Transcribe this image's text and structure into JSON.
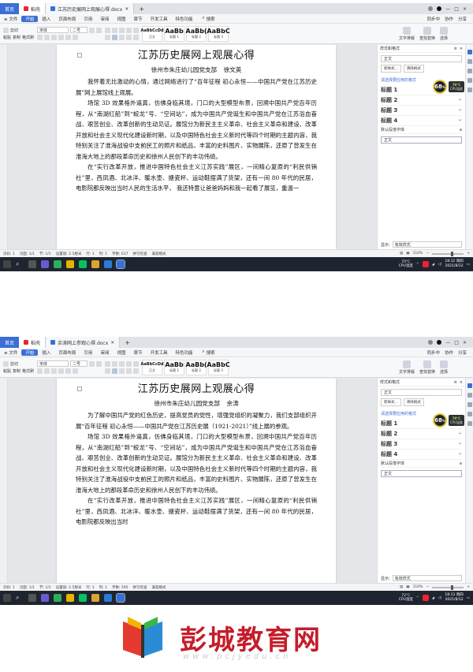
{
  "screenshots": [
    {
      "tabs": {
        "home": "首页",
        "t2": "稻壳",
        "doc": "江苏历史展网上观展心得.docx"
      },
      "menu": {
        "file": "文件",
        "items": [
          "开始",
          "插入",
          "页面布局",
          "引用",
          "审阅",
          "视图",
          "章节",
          "开发工具",
          "特色功能"
        ],
        "search": "搜索",
        "sync": "同步中",
        "collab": "协作",
        "share": "分享"
      },
      "ribbon": {
        "paste": "粘贴",
        "cut": "剪切",
        "copy": "复制",
        "format_painter": "格式刷",
        "font": "宋体",
        "size": "二号",
        "styles": [
          {
            "preview": "AaBbCcDd",
            "name": "正文"
          },
          {
            "preview": "AaBb",
            "name": "标题 1"
          },
          {
            "preview": "AaBb(",
            "name": "标题 2"
          },
          {
            "preview": "AaBbC",
            "name": "标题 3"
          }
        ],
        "text_tools": "文字排版",
        "find_replace": "查找替换",
        "select": "选择"
      },
      "doc": {
        "title": "江苏历史展网上观展心得",
        "subtitle": "徐州市朱庄幼儿园党支部    徐文英",
        "paragraphs": [
          "我怀着无比激动的心情，通过网络进行了“百年征程 初心永恒——中国共产党在江苏历史展”网上展馆线上观展。",
          "场馆 3D 效果格外逼真，仿佛身临其境，门口的大型模型布景，回溯中国共产党百年历程，从“南湖红船”到“蛟龙”号、“空间站”，成为中国共产党诞生和中国共产党在江苏浴血奋战、艰苦创业、改革创新的生动见证。展馆分为新民主主义革命、社会主义革命和建设、改革开放和社会主义现代化建设新时期，以及中国特色社会主义新时代等四个时期的主题内容，我特别关注了淮海战役中支前民工的照片和纸品，丰富的史料图片、实物展陈，还原了曾发生在淮海大地上的那段革命历史和徐州人民创下的丰功伟绩。",
          "在“实行改革开放，推进中国特色社会主义江苏实践”展区，一间精心复原的“利民供销社”里，西凤酒、北冰洋、暖水壶、搪瓷杯、运动鞋摆满了货架，还有一间 80 年代的民居，电影院都反映出当时人民的生活水平， 我还特意让爸爸妈妈和我一起看了展览，重温一"
        ]
      },
      "panel": {
        "title": "样式和格式",
        "current": "正文",
        "new_style": "新样式...",
        "clear": "清除格式",
        "apply_label": "请选择要应用的格式",
        "headings": [
          "标题 1",
          "标题 2",
          "标题 3",
          "标题 4"
        ],
        "default_font": "默认段落字体",
        "body": "正文",
        "show_label": "显示:",
        "show_value": "有效样式"
      },
      "badge": {
        "value": "68",
        "unit": "%",
        "temp": "70°C",
        "temp_label": "CPU温度"
      },
      "status": {
        "page": "页码: 1",
        "pages": "页面: 1/1",
        "section": "节: 1/1",
        "setting": "设置值: 2.5厘米",
        "row": "行: 1",
        "col": "列: 1",
        "words": "字数: 617",
        "spell": "拼写检查",
        "compat": "兼容模式",
        "zoom": "110%"
      },
      "taskbar": {
        "weather_temp": "70°C",
        "weather_label": "CPU温度",
        "time": "18:12 周四",
        "date": "2021/8/12"
      }
    },
    {
      "tabs": {
        "home": "首页",
        "t2": "稻壳",
        "doc": "余涛网上参观心得.docx"
      },
      "menu": {
        "file": "文件",
        "items": [
          "开始",
          "插入",
          "页面布局",
          "引用",
          "审阅",
          "视图",
          "章节",
          "开发工具",
          "特色功能"
        ],
        "search": "搜索",
        "sync": "同步中",
        "collab": "协作",
        "share": "分享"
      },
      "ribbon": {
        "paste": "粘贴",
        "cut": "剪切",
        "copy": "复制",
        "format_painter": "格式刷",
        "font": "宋体",
        "size": "二号",
        "styles": [
          {
            "preview": "AaBbCcDd",
            "name": "正文"
          },
          {
            "preview": "AaBb",
            "name": "标题 1"
          },
          {
            "preview": "AaBb(",
            "name": "标题 2"
          },
          {
            "preview": "AaBbC",
            "name": "标题 3"
          }
        ],
        "text_tools": "文字排版",
        "find_replace": "查找替换",
        "select": "选择"
      },
      "doc": {
        "title": "江苏历史展网上观展心得",
        "subtitle": "徐州市朱庄幼儿园党支部    余涛",
        "paragraphs": [
          "为了解中国共产党的红色历史，提高党员的党性，增强党组织的凝聚力，我们支部组织开展“百年征程 初心永恒——中国共产党在江苏历史展（1921-2021）”线上展的参观。",
          "场馆 3D 效果格外逼真，仿佛身临其境，门口的大型模型布景，回溯中国共产党百年历程，从“南湖红船”到“蛟龙”号、“空间站”，成为中国共产党诞生和中国共产党在江苏浴血奋战、艰苦创业、改革创新的生动见证。展馆分为新民主主义革命、社会主义革命和建设、改革开放和社会主义现代化建设新时期，以及中国特色社会主义新时代等四个时期的主题内容，我特别关注了淮海战役中支前民工的照片和纸品，丰富的史料图片、实物展陈，还原了曾发生在淮海大地上的那段革命历史和徐州人民创下的丰功伟绩。",
          "在“实行改革开放，推进中国特色社会主义江苏实践”展区，一间精心复原的“利民供销社”里，西凤酒、北冰洋、暖水壶、搪瓷杯、运动鞋摆满了货架，还有一间 80 年代的民居，电影院都反映出当时"
        ]
      },
      "panel": {
        "title": "样式和格式",
        "current": "正文",
        "new_style": "新样式...",
        "clear": "清除格式",
        "apply_label": "请选择要应用的格式",
        "headings": [
          "标题 1",
          "标题 2",
          "标题 3",
          "标题 4"
        ],
        "default_font": "默认段落字体",
        "body": "正文",
        "show_label": "显示:",
        "show_value": "有效样式"
      },
      "badge": {
        "value": "68",
        "unit": "%",
        "temp": "70°C",
        "temp_label": "CPU温度"
      },
      "status": {
        "page": "页码: 1",
        "pages": "页面: 1/1",
        "section": "节: 1/1",
        "setting": "设置值: 2.5厘米",
        "row": "行: 1",
        "col": "列: 1",
        "words": "字数: 595",
        "spell": "拼写检查",
        "compat": "兼容模式",
        "zoom": "110%"
      },
      "taskbar": {
        "weather_temp": "72°C",
        "weather_label": "CPU温度",
        "time": "18:13 周四",
        "date": "2021/8/12"
      }
    }
  ],
  "watermark": {
    "brand": "彭城教育网",
    "url": "www.pcjyedu.cn"
  }
}
